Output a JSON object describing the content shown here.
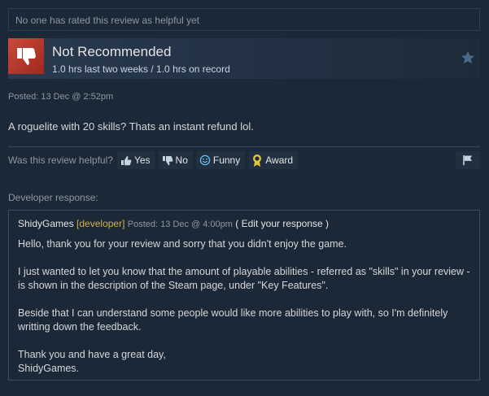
{
  "helpful_top": "No one has rated this review as helpful yet",
  "review": {
    "title": "Not Recommended",
    "hours": "1.0 hrs last two weeks / 1.0 hrs on record",
    "posted": "Posted: 13 Dec @ 2:52pm",
    "text": "A roguelite with 20 skills? Thats an instant refund lol."
  },
  "vote": {
    "question": "Was this review helpful?",
    "yes": "Yes",
    "no": "No",
    "funny": "Funny",
    "award": "Award"
  },
  "developer": {
    "label": "Developer response:",
    "name": "ShidyGames",
    "tag": "[developer]",
    "posted": "Posted: 13 Dec @ 4:00pm",
    "edit": "( Edit your response )",
    "paragraphs": [
      "Hello, thank you for your review and sorry that you didn't enjoy the game.",
      "I just wanted to let you know that the amount of playable abilities - referred as \"skills\" in your review - is shown in the description of the Steam page, under \"Key Features\".",
      "Beside that I can understand some people would like more abilities to play with, so I'm definitely writting down the feedback.",
      "Thank you and have a great day,\nShidyGames."
    ]
  },
  "colors": {
    "background": "#1b2838",
    "thumb_down": "#c94a3a",
    "developer_tag": "#d4b14a"
  }
}
